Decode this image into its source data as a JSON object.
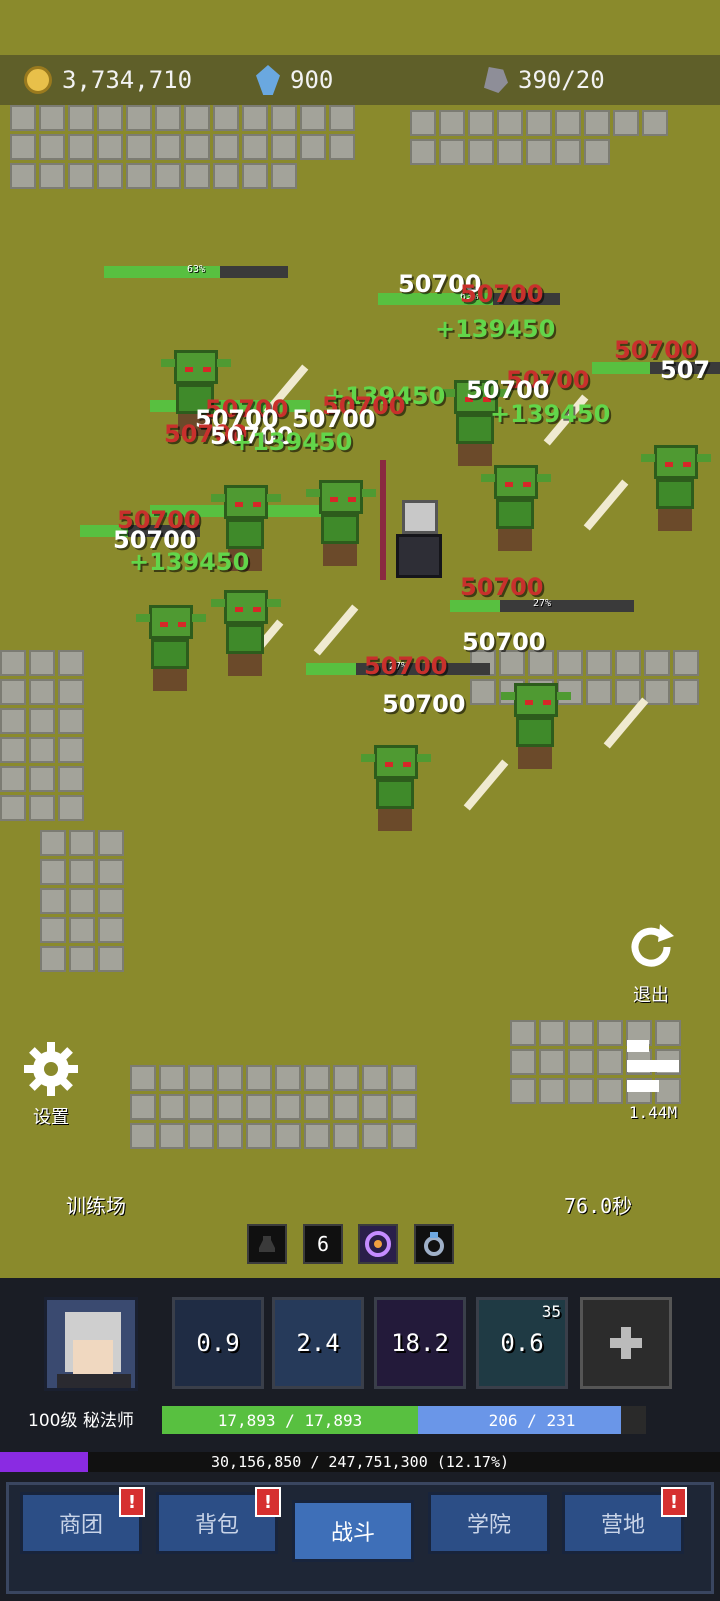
{
  "resources": {
    "gold": "3,734,710",
    "gems": "900",
    "ore": "390/20"
  },
  "field": {
    "location": "训练场",
    "timer": "76.0秒",
    "exit_label": "退出",
    "settings_label": "设置",
    "dps": "1.44M",
    "quick_count": "6"
  },
  "hp_labels": [
    "63%",
    "63%",
    "100%",
    "27%",
    "27%"
  ],
  "damage_texts": {
    "red": "50700",
    "white": "50700",
    "heal": "+139450",
    "heal2": "+139450",
    "cut": "507"
  },
  "skills": [
    {
      "cooldown": "0.9"
    },
    {
      "cooldown": "2.4"
    },
    {
      "cooldown": "18.2"
    },
    {
      "cooldown": "0.6",
      "stack": "35"
    }
  ],
  "player": {
    "level_class": "100级 秘法师",
    "hp": "17,893 / 17,893",
    "hp_fraction": 1.0,
    "mp": "206 / 231",
    "mp_fraction": 0.89,
    "xp": "30,156,850 / 247,751,300 (12.17%)",
    "xp_fraction": 0.1217
  },
  "tabs": [
    {
      "label": "商团",
      "alert": "!"
    },
    {
      "label": "背包",
      "alert": "!"
    },
    {
      "label": "战斗"
    },
    {
      "label": "学院"
    },
    {
      "label": "营地",
      "alert": "!"
    }
  ],
  "colors": {
    "grass": "#8a8a2c",
    "hp_green": "#58c040",
    "mp_blue": "#6a96e8",
    "xp_purple": "#8a2be2",
    "damage_red": "#c8302c",
    "heal_green": "#62d64a",
    "tab_blue": "#2c4e86",
    "alert_red": "#d63030"
  }
}
